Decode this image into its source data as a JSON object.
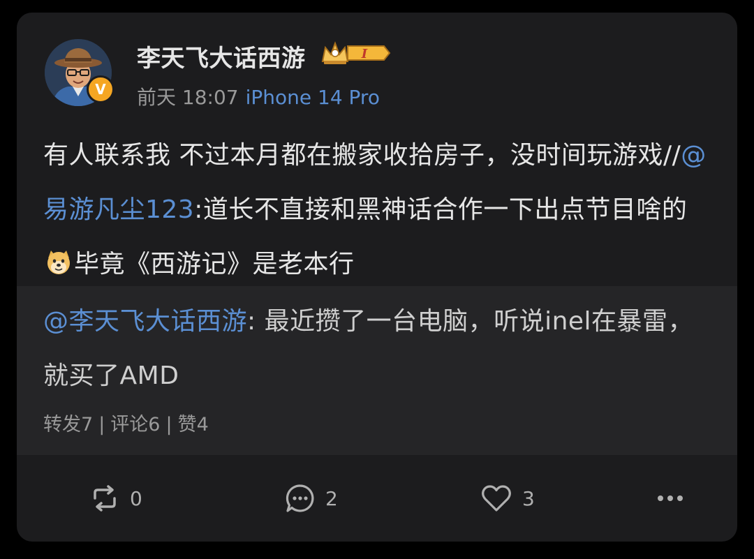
{
  "post": {
    "username": "李天飞大话西游",
    "badge_level": "I",
    "time": "前天 18:07",
    "device": "iPhone 14 Pro",
    "text_part1": "有人联系我 不过本月都在搬家收拾房子，没时间玩游戏//",
    "mention1": "@易游凡尘123",
    "text_part2": ":道长不直接和黑神话合作一下出点节目啥的",
    "emoji": "doge-emoji",
    "text_part3": "毕竟《西游记》是老本行"
  },
  "quote": {
    "mention": "@李天飞大话西游",
    "text": ": 最近攒了一台电脑，听说inel在暴雷，就买了AMD",
    "stats": {
      "repost": "转发7",
      "comment": "评论6",
      "like": "赞4",
      "separator": "|"
    }
  },
  "actions": {
    "repost_count": "0",
    "comment_count": "2",
    "like_count": "3"
  },
  "icons": {
    "repost": "repost-icon",
    "comment": "comment-icon",
    "like": "heart-icon",
    "more": "more-icon",
    "verified": "verified-icon"
  },
  "colors": {
    "background": "#000000",
    "card": "#1c1c1e",
    "quote_bg": "#252527",
    "link": "#5b8fd3",
    "verified": "#f5a623"
  }
}
